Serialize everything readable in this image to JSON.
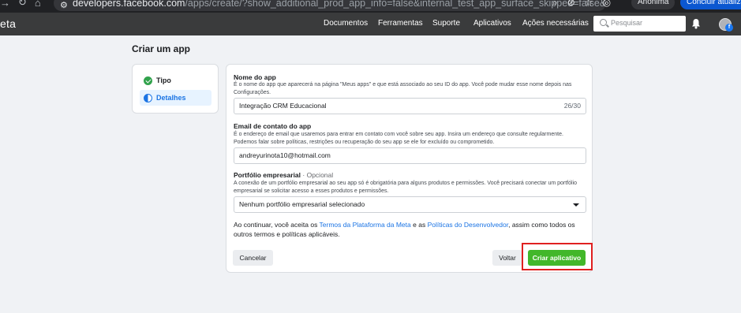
{
  "browser": {
    "url_host": "developers.facebook.com",
    "url_path": "/apps/create/?show_additional_prod_app_info=false&internal_test_app_surface_skipped=false&app_name_input=Integraçã...",
    "incognito_label": "Anônima",
    "update_label": "Concluir atualização"
  },
  "nav": {
    "logo": "eta",
    "items": [
      "Documentos",
      "Ferramentas",
      "Suporte",
      "Aplicativos",
      "Ações necessárias"
    ],
    "search_placeholder": "Pesquisar"
  },
  "page": {
    "title": "Criar um app"
  },
  "steps": [
    {
      "label": "Tipo",
      "state": "done",
      "icon": "check-circle-icon"
    },
    {
      "label": "Detalhes",
      "state": "active",
      "icon": "half-circle-icon"
    }
  ],
  "form": {
    "app_name": {
      "label": "Nome do app",
      "description": "É o nome do app que aparecerá na página \"Meus apps\" e que está associado ao seu ID do app. Você pode mudar esse nome depois nas Configurações.",
      "value": "Integração CRM Educacional",
      "counter": "26/30"
    },
    "contact_email": {
      "label": "Email de contato do app",
      "description": "É o endereço de email que usaremos para entrar em contato com você sobre seu app. Insira um endereço que consulte regularmente. Podemos falar sobre políticas, restrições ou recuperação do seu app se ele for excluído ou comprometido.",
      "value": "andreyurinota10@hotmail.com"
    },
    "business_portfolio": {
      "label": "Portfólio empresarial",
      "optional": "· Opcional",
      "description": "A conexão de um portfólio empresarial ao seu app só é obrigatória para alguns produtos e permissões. Você precisará conectar um portfólio empresarial se solicitar acesso a esses produtos e permissões.",
      "selected": "Nenhum portfólio empresarial selecionado"
    },
    "terms": {
      "prefix": "Ao continuar, você aceita os ",
      "link1": "Termos da Plataforma da Meta",
      "middle": " e as ",
      "link2": "Políticas do Desenvolvedor",
      "suffix": ", assim como todos os outros termos e políticas aplicáveis."
    },
    "buttons": {
      "cancel": "Cancelar",
      "back": "Voltar",
      "create": "Criar aplicativo"
    }
  },
  "colors": {
    "accent": "#1b74e4",
    "primary_button": "#42b72a",
    "highlight": "#e02020",
    "nav_bg": "#3a3b3c"
  }
}
